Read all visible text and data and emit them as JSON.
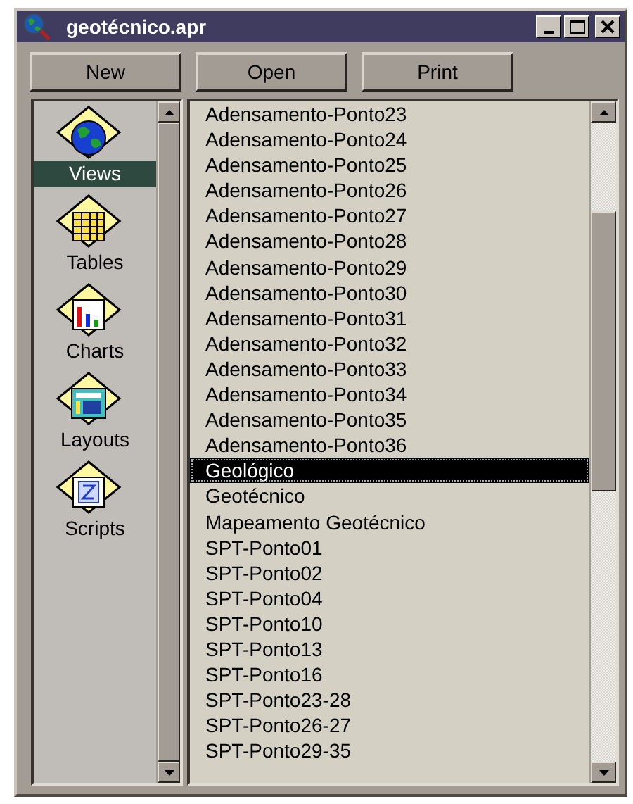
{
  "window": {
    "title": "geotécnico.apr"
  },
  "buttons": [
    "New",
    "Open",
    "Print"
  ],
  "sidebar": {
    "items": [
      {
        "label": "Views",
        "kind": "views",
        "selected": true
      },
      {
        "label": "Tables",
        "kind": "tables",
        "selected": false
      },
      {
        "label": "Charts",
        "kind": "charts",
        "selected": false
      },
      {
        "label": "Layouts",
        "kind": "layouts",
        "selected": false
      },
      {
        "label": "Scripts",
        "kind": "scripts",
        "selected": false
      }
    ]
  },
  "list": {
    "items": [
      {
        "label": "Adensamento-Ponto23",
        "selected": false
      },
      {
        "label": "Adensamento-Ponto24",
        "selected": false
      },
      {
        "label": "Adensamento-Ponto25",
        "selected": false
      },
      {
        "label": "Adensamento-Ponto26",
        "selected": false
      },
      {
        "label": "Adensamento-Ponto27",
        "selected": false
      },
      {
        "label": "Adensamento-Ponto28",
        "selected": false
      },
      {
        "label": "Adensamento-Ponto29",
        "selected": false
      },
      {
        "label": "Adensamento-Ponto30",
        "selected": false
      },
      {
        "label": "Adensamento-Ponto31",
        "selected": false
      },
      {
        "label": "Adensamento-Ponto32",
        "selected": false
      },
      {
        "label": "Adensamento-Ponto33",
        "selected": false
      },
      {
        "label": "Adensamento-Ponto34",
        "selected": false
      },
      {
        "label": "Adensamento-Ponto35",
        "selected": false
      },
      {
        "label": "Adensamento-Ponto36",
        "selected": false
      },
      {
        "label": "Geológico",
        "selected": true
      },
      {
        "label": "Geotécnico",
        "selected": false
      },
      {
        "label": "Mapeamento Geotécnico",
        "selected": false
      },
      {
        "label": "SPT-Ponto01",
        "selected": false
      },
      {
        "label": "SPT-Ponto02",
        "selected": false
      },
      {
        "label": "SPT-Ponto04",
        "selected": false
      },
      {
        "label": "SPT-Ponto10",
        "selected": false
      },
      {
        "label": "SPT-Ponto13",
        "selected": false
      },
      {
        "label": "SPT-Ponto16",
        "selected": false
      },
      {
        "label": "SPT-Ponto23-28",
        "selected": false
      },
      {
        "label": "SPT-Ponto26-27",
        "selected": false
      },
      {
        "label": "SPT-Ponto29-35",
        "selected": false
      }
    ]
  }
}
